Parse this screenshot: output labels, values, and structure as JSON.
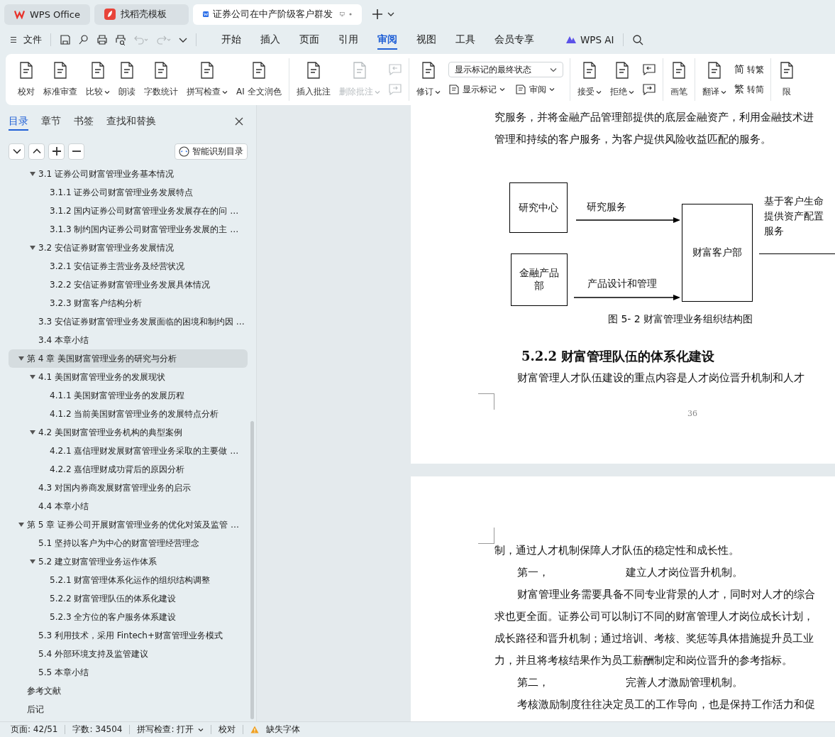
{
  "app_tabs": [
    {
      "label": "WPS Office",
      "selected": false,
      "kind": "home"
    },
    {
      "label": "找稻壳模板",
      "selected": false,
      "kind": "template"
    },
    {
      "label": "证券公司在中产阶级客户群发",
      "selected": true,
      "kind": "document"
    }
  ],
  "menu": {
    "file": "文件",
    "quick_access": {
      "undo_disabled": true,
      "redo_disabled": true
    },
    "tabs": [
      {
        "label": "开始",
        "selected": false
      },
      {
        "label": "插入",
        "selected": false
      },
      {
        "label": "页面",
        "selected": false
      },
      {
        "label": "引用",
        "selected": false
      },
      {
        "label": "审阅",
        "selected": true
      },
      {
        "label": "视图",
        "selected": false
      },
      {
        "label": "工具",
        "selected": false
      },
      {
        "label": "会员专享",
        "selected": false
      }
    ],
    "ai": "WPS AI"
  },
  "ribbon": {
    "groups": [
      {
        "items": [
          {
            "kind": "large",
            "label": "校对",
            "menu": false,
            "disabled": false
          },
          {
            "kind": "large",
            "label": "标准审查",
            "menu": false,
            "disabled": false
          },
          {
            "kind": "large",
            "label": "比较",
            "menu": true,
            "disabled": false
          },
          {
            "kind": "large",
            "label": "朗读",
            "menu": false,
            "disabled": false
          },
          {
            "kind": "large",
            "label": "字数统计",
            "menu": false,
            "disabled": false
          },
          {
            "kind": "large",
            "label": "拼写检查",
            "menu": true,
            "disabled": false
          },
          {
            "kind": "large",
            "label": "AI 全文润色",
            "menu": false,
            "disabled": false
          }
        ]
      },
      {
        "items": [
          {
            "kind": "large",
            "label": "插入批注",
            "menu": false,
            "disabled": false
          },
          {
            "kind": "large",
            "label": "删除批注",
            "menu": true,
            "disabled": true
          },
          {
            "kind": "icon-stack",
            "disabled": true
          }
        ]
      },
      {
        "items": [
          {
            "kind": "large",
            "label": "修订",
            "menu": true,
            "disabled": false
          },
          {
            "kind": "markup-panel",
            "select": "显示标记的最终状态",
            "buttons": [
              {
                "label": "显示标记",
                "menu": true
              },
              {
                "label": "审阅",
                "menu": true
              }
            ]
          }
        ]
      },
      {
        "items": [
          {
            "kind": "large",
            "label": "接受",
            "menu": true,
            "disabled": false
          },
          {
            "kind": "large",
            "label": "拒绝",
            "menu": true,
            "disabled": false
          },
          {
            "kind": "icon-stack",
            "disabled": false
          }
        ]
      },
      {
        "items": [
          {
            "kind": "large",
            "label": "画笔",
            "menu": false,
            "disabled": false
          }
        ]
      },
      {
        "items": [
          {
            "kind": "large",
            "label": "翻译",
            "menu": true,
            "disabled": false
          },
          {
            "kind": "convert-panel",
            "buttons": [
              {
                "glyph": "简",
                "label": "转繁"
              },
              {
                "glyph": "繁",
                "label": "转简"
              }
            ]
          }
        ]
      },
      {
        "items": [
          {
            "kind": "large",
            "label": "限",
            "menu": false,
            "disabled": false
          }
        ]
      }
    ]
  },
  "sidebar": {
    "tabs": [
      {
        "label": "目录",
        "selected": true
      },
      {
        "label": "章节",
        "selected": false
      },
      {
        "label": "书签",
        "selected": false
      },
      {
        "label": "查找和替换",
        "selected": false
      }
    ],
    "smart_button": "智能识别目录"
  },
  "toc": {
    "items": [
      {
        "children": [
          {
            "label": "3.1  证券公司财富管理业务基本情况",
            "selected": false,
            "expanded": true,
            "children": [
              {
                "label": "3.1.1 证券公司财富管理业务发展特点",
                "selected": false
              },
              {
                "label": "3.1.2  国内证券公司财富管理业务发展存在的问 …",
                "selected": false
              },
              {
                "label": "3.1.3  制约国内证券公司财富管理业务发展的主 …",
                "selected": false
              }
            ]
          },
          {
            "label": "3.2 安信证券财富管理业务发展情况",
            "selected": false,
            "expanded": true,
            "children": [
              {
                "label": "3.2.1  安信证券主营业务及经营状况",
                "selected": false
              },
              {
                "label": "3.2.2 安信证券财富管理业务发展具体情况",
                "selected": false
              },
              {
                "label": "3.2.3 财富客户结构分析",
                "selected": false
              }
            ]
          },
          {
            "label": "3.3 安信证券财富管理业务发展面临的困境和制约因 …",
            "selected": false
          },
          {
            "label": "3.4  本章小结",
            "selected": false
          }
        ]
      },
      {
        "label": "第 4 章  美国财富管理业务的研究与分析",
        "selected": true,
        "expanded": true,
        "children": [
          {
            "label": "4.1 美国财富管理业务的发展现状",
            "selected": false,
            "expanded": true,
            "children": [
              {
                "label": "4.1.1 美国财富管理业务的发展历程",
                "selected": false
              },
              {
                "label": "4.1.2 当前美国财富管理业务的发展特点分析",
                "selected": false
              }
            ]
          },
          {
            "label": "4.2 美国财富管理业务机构的典型案例",
            "selected": false,
            "expanded": true,
            "children": [
              {
                "label": "4.2.1  嘉信理财发展财富管理业务采取的主要做 …",
                "selected": false
              },
              {
                "label": "4.2.2 嘉信理财成功背后的原因分析",
                "selected": false
              }
            ]
          },
          {
            "label": "4.3 对国内券商发展财富管理业务的启示",
            "selected": false
          },
          {
            "label": "4.4  本章小结",
            "selected": false
          }
        ]
      },
      {
        "label": "第 5 章  证券公司开展财富管理业务的优化对策及监管 …",
        "selected": false,
        "expanded": true,
        "children": [
          {
            "label": "5.1  坚持以客户为中心的财富管理经营理念",
            "selected": false
          },
          {
            "label": "5.2  建立财富管理业务运作体系",
            "selected": false,
            "expanded": true,
            "children": [
              {
                "label": "5.2.1 财富管理体系化运作的组织结构调整",
                "selected": false
              },
              {
                "label": "5.2.2 财富管理队伍的体系化建设",
                "selected": false
              },
              {
                "label": "5.2.3  全方位的客户服务体系建设",
                "selected": false
              }
            ]
          },
          {
            "label": "5.3 利用技术，采用 Fintech+财富管理业务模式",
            "selected": false
          },
          {
            "label": "5.4 外部环境支持及监管建议",
            "selected": false
          },
          {
            "label": "5.5 本章小结",
            "selected": false
          }
        ]
      },
      {
        "label": "参考文献",
        "selected": false
      },
      {
        "label": "后记",
        "selected": false
      }
    ]
  },
  "document": {
    "pages": [
      {
        "blocks": [
          {
            "kind": "text",
            "indent": false,
            "text": "究服务，并将金融产品管理部提供的底层金融资产，利用金融技术进"
          },
          {
            "kind": "text",
            "indent": false,
            "text": "管理和持续的客户服务，为客户提供风险收益匹配的服务。"
          },
          {
            "kind": "diagram",
            "nodes": [
              {
                "label": "研究中心"
              },
              {
                "label": "金融产品部"
              },
              {
                "label": "财富客户部"
              }
            ],
            "edges": [
              {
                "label": "研究服务"
              },
              {
                "label": "产品设计和管理"
              }
            ],
            "side_note": [
              "基于客户生命",
              "提供资产配置",
              "服务"
            ]
          },
          {
            "kind": "caption",
            "text": "图 5-  2  财富管理业务组织结构图"
          },
          {
            "kind": "heading",
            "text": "5.2.2 财富管理队伍的体系化建设"
          },
          {
            "kind": "text",
            "indent": true,
            "text": "财富管理人才队伍建设的重点内容是人才岗位晋升机制和人才"
          },
          {
            "kind": "page_number",
            "text": "36"
          }
        ]
      },
      {
        "blocks": [
          {
            "kind": "text",
            "indent": false,
            "text": "制，通过人才机制保障人才队伍的稳定性和成长性。"
          },
          {
            "kind": "point",
            "lead": "第一，",
            "text": "建立人才岗位晋升机制。"
          },
          {
            "kind": "text",
            "indent": true,
            "text": "财富管理业务需要具备不同专业背景的人才，同时对人才的综合"
          },
          {
            "kind": "text",
            "indent": false,
            "text": "求也更全面。证券公司可以制订不同的财富管理人才岗位成长计划，"
          },
          {
            "kind": "text",
            "indent": false,
            "text": "成长路径和晋升机制；通过培训、考核、奖惩等具体措施提升员工业"
          },
          {
            "kind": "text",
            "indent": false,
            "text": "力，并且将考核结果作为员工薪酬制定和岗位晋升的参考指标。"
          },
          {
            "kind": "point",
            "lead": "第二，",
            "text": "完善人才激励管理机制。"
          },
          {
            "kind": "text",
            "indent": true,
            "text": "考核激励制度往往决定员工的工作导向，也是保持工作活力和促"
          }
        ]
      }
    ]
  },
  "status_bar": {
    "page": "页面: 42/51",
    "words": "字数: 34504",
    "spell": "拼写检查: 打开",
    "proof": "校对",
    "fonts": "缺失字体"
  }
}
